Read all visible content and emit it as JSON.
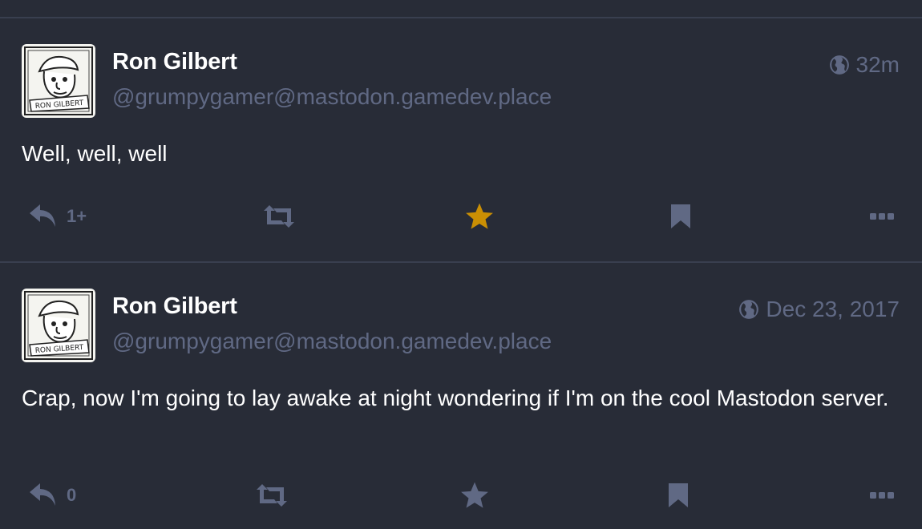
{
  "colors": {
    "background": "#282c37",
    "divider": "#393f4f",
    "muted": "#606984",
    "text": "#ffffff",
    "favourite_active": "#ca8f04"
  },
  "statuses": [
    {
      "display_name": "Ron Gilbert",
      "handle": "@grumpygamer@mastodon.gamedev.place",
      "visibility_icon": "globe-icon",
      "timestamp": "32m",
      "content": "Well, well, well",
      "reply_count": "1+",
      "favourited": true,
      "avatar_caption": "RON GILBERT"
    },
    {
      "display_name": "Ron Gilbert",
      "handle": "@grumpygamer@mastodon.gamedev.place",
      "visibility_icon": "globe-icon",
      "timestamp": "Dec 23, 2017",
      "content": "Crap, now I'm going to lay awake at night wondering if I'm on the cool Mastodon server.",
      "reply_count": "0",
      "favourited": false,
      "avatar_caption": "RON GILBERT"
    }
  ]
}
